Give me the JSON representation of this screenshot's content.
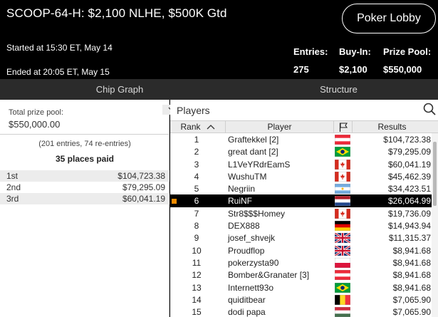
{
  "header": {
    "title": "SCOOP-64-H: $2,100 NLHE, $500K Gtd",
    "lobby_button": "Poker Lobby",
    "started": "Started at 15:30 ET, May 14",
    "ended": "Ended at 20:05 ET, May 15",
    "stats": [
      {
        "label": "Entries:",
        "value": "275"
      },
      {
        "label": "Buy-In:",
        "value": "$2,100"
      },
      {
        "label": "Prize Pool:",
        "value": "$550,000"
      }
    ]
  },
  "tabs": [
    {
      "label": "Chip Graph"
    },
    {
      "label": "Structure"
    }
  ],
  "left_panel": {
    "prize_label": "Total prize pool:",
    "prize_value": "$550,000.00",
    "entries_line": "(201 entries, 74 re-entries)",
    "places_paid": "35 places paid",
    "payouts": [
      {
        "place": "1st",
        "amount": "$104,723.38"
      },
      {
        "place": "2nd",
        "amount": "$79,295.09"
      },
      {
        "place": "3rd",
        "amount": "$60,041.19"
      }
    ]
  },
  "players_panel": {
    "title": "Players",
    "columns": {
      "rank": "Rank",
      "player": "Player",
      "results": "Results"
    },
    "selected_rank": "6",
    "rows": [
      {
        "rank": "1",
        "player": "Graftekkel [2]",
        "flag": "austria",
        "result": "$104,723.38"
      },
      {
        "rank": "2",
        "player": "great dant [2]",
        "flag": "brazil",
        "result": "$79,295.09"
      },
      {
        "rank": "3",
        "player": "L1VeYRdrEamS",
        "flag": "canada",
        "result": "$60,041.19"
      },
      {
        "rank": "4",
        "player": "WushuTM",
        "flag": "canada",
        "result": "$45,462.39"
      },
      {
        "rank": "5",
        "player": "Negriin",
        "flag": "argentina",
        "result": "$34,423.51"
      },
      {
        "rank": "6",
        "player": "RuiNF",
        "flag": "netherlands",
        "result": "$26,064.99"
      },
      {
        "rank": "7",
        "player": "Str8$$$Homey",
        "flag": "canada",
        "result": "$19,736.09"
      },
      {
        "rank": "8",
        "player": "DEX888",
        "flag": "germany",
        "result": "$14,943.94"
      },
      {
        "rank": "9",
        "player": "josef_shvejk",
        "flag": "uk",
        "result": "$11,315.37"
      },
      {
        "rank": "10",
        "player": "Proudflop",
        "flag": "uk",
        "result": "$8,941.68"
      },
      {
        "rank": "11",
        "player": "pokerzysta90",
        "flag": "poland",
        "result": "$8,941.68"
      },
      {
        "rank": "12",
        "player": "Bomber&Granater [3]",
        "flag": "austria",
        "result": "$8,941.68"
      },
      {
        "rank": "13",
        "player": "Internett93o",
        "flag": "brazil",
        "result": "$8,941.68"
      },
      {
        "rank": "14",
        "player": "quiditbear",
        "flag": "belgium",
        "result": "$7,065.90"
      },
      {
        "rank": "15",
        "player": "dodi papa",
        "flag": "hungary",
        "result": "$7,065.90"
      }
    ]
  },
  "colors": {
    "header_bg": "#000000",
    "tab_bg": "#2b2b2b",
    "selected_row_bg": "#000000",
    "selected_marker": "#f28c00"
  }
}
